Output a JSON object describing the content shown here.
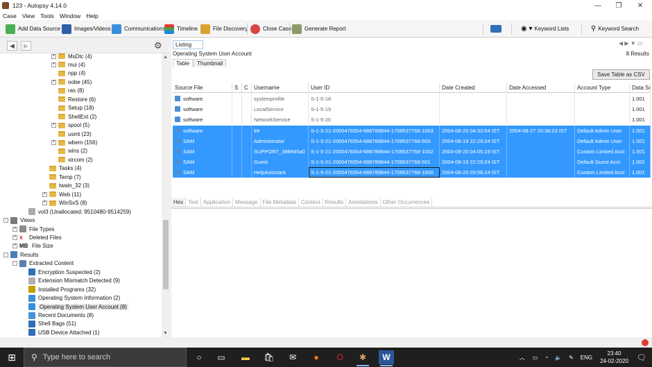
{
  "window": {
    "title": "123 - Autopsy 4.14.0",
    "controls": [
      "—",
      "❐",
      "✕"
    ]
  },
  "menu": [
    "Case",
    "View",
    "Tools",
    "Window",
    "Help"
  ],
  "toolbar": {
    "add_data_source": "Add Data Source",
    "images_videos": "Images/Videos",
    "communications": "Communications",
    "timeline": "Timeline",
    "file_discovery": "File Discovery",
    "close_case": "Close Case",
    "generate_report": "Generate Report",
    "keyword_lists": "Keyword Lists",
    "keyword_search": "Keyword Search"
  },
  "tree": [
    {
      "label": "MsDtc (4)",
      "level": 5,
      "exp": "+",
      "kind": "folder"
    },
    {
      "label": "mui (4)",
      "level": 5,
      "exp": "+",
      "kind": "folder"
    },
    {
      "label": "npp (4)",
      "level": 5,
      "exp": "",
      "kind": "folder"
    },
    {
      "label": "oobe (45)",
      "level": 5,
      "exp": "+",
      "kind": "folder"
    },
    {
      "label": "ras (8)",
      "level": 5,
      "exp": "",
      "kind": "folder"
    },
    {
      "label": "Restore (6)",
      "level": 5,
      "exp": "",
      "kind": "folder"
    },
    {
      "label": "Setup (18)",
      "level": 5,
      "exp": "",
      "kind": "folder"
    },
    {
      "label": "ShellExt (2)",
      "level": 5,
      "exp": "",
      "kind": "folder"
    },
    {
      "label": "spool (5)",
      "level": 5,
      "exp": "+",
      "kind": "folder"
    },
    {
      "label": "usmt (23)",
      "level": 5,
      "exp": "",
      "kind": "folder"
    },
    {
      "label": "wbem (156)",
      "level": 5,
      "exp": "+",
      "kind": "folder"
    },
    {
      "label": "wins (2)",
      "level": 5,
      "exp": "",
      "kind": "folder"
    },
    {
      "label": "xircom (2)",
      "level": 5,
      "exp": "",
      "kind": "folder"
    },
    {
      "label": "Tasks (4)",
      "level": 4,
      "exp": "",
      "kind": "folder"
    },
    {
      "label": "Temp (7)",
      "level": 4,
      "exp": "",
      "kind": "folder"
    },
    {
      "label": "twain_32 (3)",
      "level": 4,
      "exp": "",
      "kind": "folder"
    },
    {
      "label": "Web (11)",
      "level": 4,
      "exp": "+",
      "kind": "folder"
    },
    {
      "label": "WinSxS (8)",
      "level": 4,
      "exp": "+",
      "kind": "folder"
    },
    {
      "label": "vol3 (Unallocated: 9510480-9514259)",
      "level": 2,
      "exp": "",
      "kind": "vol"
    },
    {
      "label": "Views",
      "level": 0,
      "exp": "-",
      "kind": "views"
    },
    {
      "label": "File Types",
      "level": 1,
      "exp": "+",
      "kind": "ftypes"
    },
    {
      "label": "Deleted Files",
      "level": 1,
      "exp": "+",
      "kind": "deleted"
    },
    {
      "label": "File Size",
      "level": 1,
      "exp": "+",
      "kind": "mb"
    },
    {
      "label": "Results",
      "level": 0,
      "exp": "-",
      "kind": "results"
    },
    {
      "label": "Extracted Content",
      "level": 1,
      "exp": "-",
      "kind": "extracted"
    },
    {
      "label": "Encryption Suspected (2)",
      "level": 2,
      "exp": "",
      "kind": "enc"
    },
    {
      "label": "Extension Mismatch Detected (9)",
      "level": 2,
      "exp": "",
      "kind": "ext"
    },
    {
      "label": "Installed Programs (32)",
      "level": 2,
      "exp": "",
      "kind": "prog"
    },
    {
      "label": "Operating System Information (2)",
      "level": 2,
      "exp": "",
      "kind": "osinfo"
    },
    {
      "label": "Operating System User Account (8)",
      "level": 2,
      "exp": "",
      "kind": "osuser",
      "selected": true
    },
    {
      "label": "Recent Documents (8)",
      "level": 2,
      "exp": "",
      "kind": "recent"
    },
    {
      "label": "Shell Bags (51)",
      "level": 2,
      "exp": "",
      "kind": "shell"
    },
    {
      "label": "USB Device Attached (1)",
      "level": 2,
      "exp": "",
      "kind": "usb"
    }
  ],
  "listing": {
    "tab": "Listing",
    "header": "Operating System User Account",
    "results": "8  Results",
    "subtabs": [
      "Table",
      "Thumbnail"
    ],
    "save_csv": "Save Table as CSV",
    "columns": [
      "Source File",
      "S",
      "C",
      "Username",
      "User ID",
      "Date Created",
      "Date Accessed",
      "Account Type",
      "Data Sc"
    ],
    "rows": [
      {
        "source": "software",
        "username": "systemprofile",
        "userid": "S-1-5-18",
        "created": "",
        "accessed": "",
        "type": "",
        "data": "1.001",
        "selected": false
      },
      {
        "source": "software",
        "username": "LocalService",
        "userid": "S-1-5-19",
        "created": "",
        "accessed": "",
        "type": "",
        "data": "1.001",
        "selected": false
      },
      {
        "source": "software",
        "username": "NetworkService",
        "userid": "S-1-5-20",
        "created": "",
        "accessed": "",
        "type": "",
        "data": "1.001",
        "selected": false
      },
      {
        "source": "software",
        "username": "Mr",
        "userid": "S-1-5-21-2000478354-688789844-1708537768-1003",
        "created": "2004-08-20 04:33:54 IST",
        "accessed": "2004-08-27 20:38:23 IST",
        "type": "Default Admin User",
        "data": "1.001",
        "selected": true
      },
      {
        "source": "SAM",
        "username": "Administrator",
        "userid": "S-1-5-21-2000478354-688789844-1708537768-500",
        "created": "2004-08-19 22:29:24 IST",
        "accessed": "",
        "type": "Default Admin User",
        "data": "1.001",
        "selected": true
      },
      {
        "source": "SAM",
        "username": "SUPPORT_388945a0",
        "userid": "S-1-5-21-2000478354-688789844-1708537768-1002",
        "created": "2004-08-20 04:05:19 IST",
        "accessed": "",
        "type": "Custom Limited Acct",
        "data": "1.001",
        "selected": true
      },
      {
        "source": "SAM",
        "username": "Guest",
        "userid": "S-1-5-21-2000478354-688789844-1708537768-501",
        "created": "2004-08-19 22:29:24 IST",
        "accessed": "",
        "type": "Default Guest Acct",
        "data": "1.001",
        "selected": true
      },
      {
        "source": "SAM",
        "username": "HelpAssistant",
        "userid": "S-1-5-21-2000478354-688789844-1708537768-1000",
        "created": "2004-08-20 03:58:24 IST",
        "accessed": "",
        "type": "Custom Limited Acct",
        "data": "1.001",
        "selected": true,
        "focus_userid": true
      }
    ]
  },
  "content_tabs": [
    "Hex",
    "Text",
    "Application",
    "Message",
    "File Metadata",
    "Context",
    "Results",
    "Annotations",
    "Other Occurrences"
  ],
  "taskbar": {
    "search_placeholder": "Type here to search",
    "lang": "ENG",
    "time": "23:40",
    "date": "24-02-2020"
  },
  "colors": {
    "selection": "#3399ff",
    "taskbar": "#1f1f1f",
    "folder": "#e6b84a"
  }
}
